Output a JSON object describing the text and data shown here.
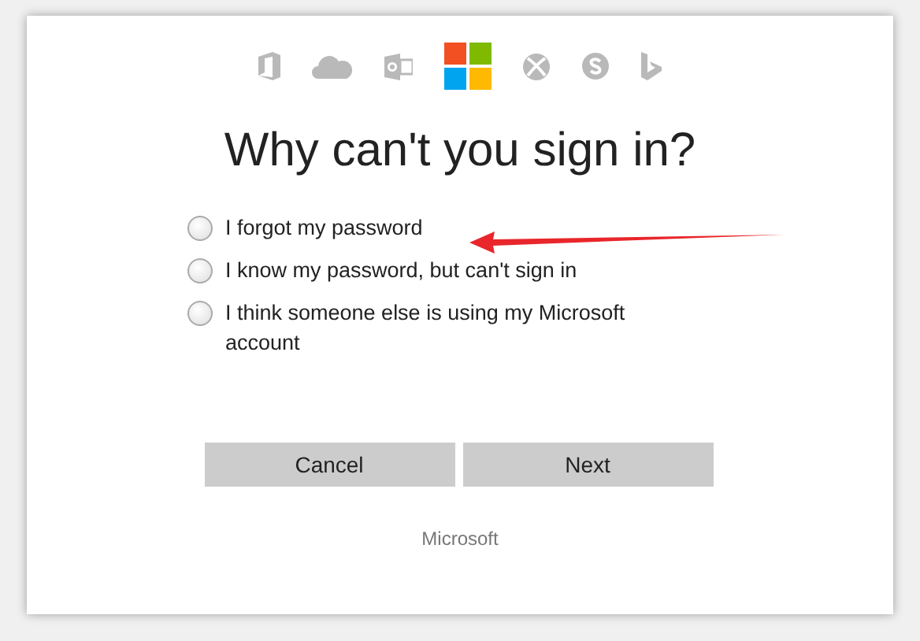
{
  "title": "Why can't you sign in?",
  "options": [
    {
      "label": "I forgot my password",
      "selected": false
    },
    {
      "label": "I know my password, but can't sign in",
      "selected": false
    },
    {
      "label": "I think someone else is using my Microsoft account",
      "selected": false
    }
  ],
  "buttons": [
    "Cancel",
    "Next"
  ],
  "footer": "Microsoft"
}
